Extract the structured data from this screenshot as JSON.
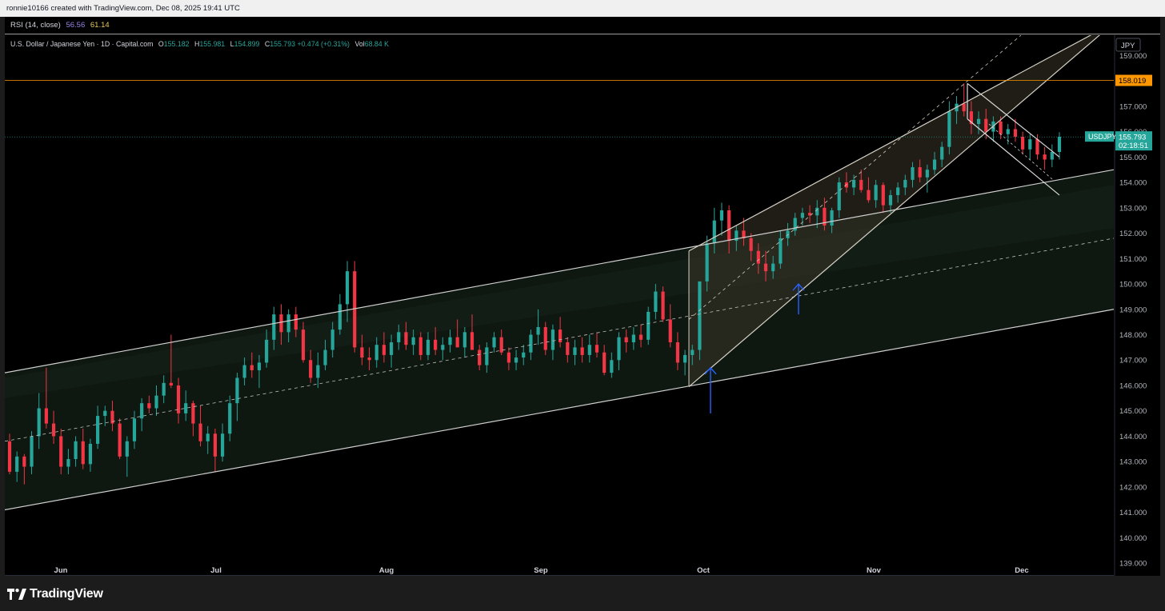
{
  "header": {
    "credit": "ronnie10166 created with TradingView.com, Dec 08, 2025 19:41 UTC"
  },
  "rsi": {
    "label": "RSI (14, close)",
    "value1": "56.56",
    "value2": "61.14"
  },
  "legend": {
    "symbol": "U.S. Dollar / Japanese Yen · 1D · Capital.com",
    "o_label": "O",
    "o": "155.182",
    "h_label": "H",
    "h": "155.981",
    "l_label": "L",
    "l": "154.899",
    "c_label": "C",
    "c": "155.793",
    "change": "+0.474 (+0.31%)",
    "vol_label": "Vol",
    "vol": "68.84 K"
  },
  "brand": {
    "name": "TradingView"
  },
  "chart_data": {
    "type": "candlestick",
    "currency": "JPY",
    "ticker": "USDJPY",
    "last_price": "155.793",
    "countdown": "02:18:51",
    "resistance": "158.019",
    "y_ticks": [
      "159.000",
      "158.000",
      "157.000",
      "156.000",
      "155.000",
      "154.000",
      "153.000",
      "152.000",
      "151.000",
      "150.000",
      "149.000",
      "148.000",
      "147.000",
      "146.000",
      "145.000",
      "144.000",
      "143.000",
      "142.000",
      "141.000",
      "140.000",
      "139.000"
    ],
    "x_ticks": [
      "Jun",
      "Jul",
      "Aug",
      "Sep",
      "Oct",
      "Nov",
      "Dec"
    ],
    "ylim": [
      138.5,
      159.8
    ],
    "colors": {
      "up": "#26a69a",
      "down": "#f23645",
      "resistance": "#ff9800",
      "arrows": "#2962ff"
    },
    "candles": [
      [
        143.8,
        144.1,
        142.5,
        142.6
      ],
      [
        142.6,
        143.4,
        142.2,
        143.2
      ],
      [
        143.2,
        143.3,
        142.1,
        142.8
      ],
      [
        142.8,
        144.2,
        142.5,
        144.0
      ],
      [
        144.0,
        145.7,
        143.5,
        145.1
      ],
      [
        145.1,
        146.7,
        144.3,
        144.5
      ],
      [
        144.5,
        145.0,
        143.7,
        144.0
      ],
      [
        144.0,
        144.3,
        142.5,
        142.8
      ],
      [
        142.8,
        143.5,
        142.5,
        143.1
      ],
      [
        143.1,
        144.0,
        142.8,
        143.8
      ],
      [
        143.8,
        144.3,
        142.7,
        142.9
      ],
      [
        142.9,
        143.9,
        142.6,
        143.7
      ],
      [
        143.7,
        145.2,
        143.5,
        144.8
      ],
      [
        144.8,
        145.2,
        144.4,
        145.0
      ],
      [
        145.0,
        145.4,
        144.2,
        144.5
      ],
      [
        144.5,
        144.7,
        143.1,
        143.2
      ],
      [
        143.2,
        144.0,
        142.4,
        143.8
      ],
      [
        143.8,
        145.0,
        143.5,
        144.7
      ],
      [
        144.7,
        145.5,
        144.2,
        145.3
      ],
      [
        145.3,
        145.6,
        144.9,
        145.1
      ],
      [
        145.1,
        146.0,
        144.8,
        145.6
      ],
      [
        145.6,
        146.4,
        145.3,
        146.1
      ],
      [
        146.1,
        148.0,
        145.9,
        146.0
      ],
      [
        146.0,
        146.3,
        144.5,
        144.9
      ],
      [
        144.9,
        145.8,
        144.6,
        145.3
      ],
      [
        145.3,
        145.4,
        144.0,
        144.5
      ],
      [
        144.5,
        145.2,
        143.6,
        143.8
      ],
      [
        143.8,
        144.4,
        143.3,
        144.1
      ],
      [
        144.1,
        144.3,
        142.6,
        143.2
      ],
      [
        143.2,
        144.5,
        143.0,
        144.1
      ],
      [
        144.1,
        145.6,
        143.8,
        145.3
      ],
      [
        145.3,
        146.5,
        144.6,
        146.3
      ],
      [
        146.3,
        147.1,
        146.0,
        146.8
      ],
      [
        146.8,
        147.3,
        146.3,
        146.6
      ],
      [
        146.6,
        147.2,
        145.9,
        146.9
      ],
      [
        146.9,
        148.2,
        146.7,
        147.8
      ],
      [
        147.8,
        149.1,
        147.4,
        148.8
      ],
      [
        148.8,
        149.2,
        147.6,
        148.1
      ],
      [
        148.1,
        149.0,
        147.7,
        148.8
      ],
      [
        148.8,
        149.1,
        147.9,
        148.2
      ],
      [
        148.2,
        148.5,
        146.9,
        147.0
      ],
      [
        147.0,
        147.4,
        146.1,
        146.3
      ],
      [
        146.3,
        147.3,
        145.9,
        146.8
      ],
      [
        146.8,
        147.8,
        146.6,
        147.4
      ],
      [
        147.4,
        148.5,
        147.1,
        148.2
      ],
      [
        148.2,
        149.6,
        148.0,
        149.2
      ],
      [
        149.2,
        150.9,
        148.5,
        150.5
      ],
      [
        150.5,
        150.9,
        147.3,
        147.5
      ],
      [
        147.5,
        148.0,
        146.8,
        147.1
      ],
      [
        147.1,
        147.5,
        146.6,
        147.0
      ],
      [
        147.0,
        147.9,
        146.7,
        147.6
      ],
      [
        147.6,
        148.1,
        146.9,
        147.2
      ],
      [
        147.2,
        148.0,
        146.7,
        147.7
      ],
      [
        147.7,
        148.4,
        147.4,
        148.1
      ],
      [
        148.1,
        148.5,
        147.4,
        147.6
      ],
      [
        147.6,
        148.2,
        147.2,
        147.9
      ],
      [
        147.9,
        148.1,
        147.0,
        147.2
      ],
      [
        147.2,
        148.1,
        147.0,
        147.8
      ],
      [
        147.8,
        148.3,
        147.2,
        147.4
      ],
      [
        147.4,
        147.9,
        147.0,
        147.6
      ],
      [
        147.6,
        148.2,
        147.3,
        147.9
      ],
      [
        147.9,
        148.6,
        147.5,
        147.5
      ],
      [
        147.5,
        148.3,
        147.1,
        148.1
      ],
      [
        148.1,
        148.8,
        147.6,
        147.4
      ],
      [
        147.4,
        147.6,
        146.6,
        146.8
      ],
      [
        146.8,
        147.7,
        146.5,
        147.5
      ],
      [
        147.5,
        148.1,
        147.3,
        147.9
      ],
      [
        147.9,
        148.2,
        147.2,
        147.3
      ],
      [
        147.3,
        147.5,
        146.6,
        146.9
      ],
      [
        146.9,
        147.4,
        146.6,
        147.1
      ],
      [
        147.1,
        147.6,
        146.8,
        147.3
      ],
      [
        147.3,
        148.2,
        147.0,
        148.0
      ],
      [
        148.0,
        149.0,
        147.6,
        148.3
      ],
      [
        148.3,
        148.5,
        147.2,
        147.4
      ],
      [
        147.4,
        148.4,
        147.0,
        148.2
      ],
      [
        148.2,
        148.7,
        147.5,
        147.7
      ],
      [
        147.7,
        147.9,
        146.9,
        147.2
      ],
      [
        147.2,
        147.8,
        146.8,
        147.5
      ],
      [
        147.5,
        147.9,
        146.9,
        147.2
      ],
      [
        147.2,
        148.0,
        146.9,
        147.6
      ],
      [
        147.6,
        148.1,
        147.1,
        147.3
      ],
      [
        147.3,
        147.6,
        146.4,
        146.5
      ],
      [
        146.5,
        147.3,
        146.3,
        147.0
      ],
      [
        147.0,
        148.1,
        146.6,
        147.9
      ],
      [
        147.9,
        148.2,
        147.3,
        147.7
      ],
      [
        147.7,
        148.3,
        147.4,
        148.0
      ],
      [
        148.0,
        148.4,
        147.5,
        147.8
      ],
      [
        147.8,
        149.1,
        147.6,
        148.9
      ],
      [
        148.9,
        150.0,
        148.6,
        149.7
      ],
      [
        149.7,
        149.9,
        148.5,
        148.6
      ],
      [
        148.6,
        149.2,
        147.5,
        147.7
      ],
      [
        147.7,
        148.1,
        146.6,
        146.9
      ],
      [
        146.9,
        147.4,
        146.4,
        147.2
      ],
      [
        147.2,
        147.6,
        146.8,
        147.4
      ],
      [
        147.4,
        149.7,
        147.0,
        150.1
      ],
      [
        150.1,
        151.9,
        149.7,
        151.6
      ],
      [
        151.6,
        153.0,
        151.2,
        152.5
      ],
      [
        152.5,
        153.2,
        151.9,
        152.9
      ],
      [
        152.9,
        153.1,
        151.2,
        151.7
      ],
      [
        151.7,
        152.3,
        151.3,
        152.1
      ],
      [
        152.1,
        152.6,
        151.5,
        151.8
      ],
      [
        151.8,
        152.0,
        150.9,
        151.3
      ],
      [
        151.3,
        151.6,
        150.4,
        150.8
      ],
      [
        150.8,
        151.3,
        150.1,
        150.5
      ],
      [
        150.5,
        151.1,
        150.2,
        150.8
      ],
      [
        150.8,
        152.1,
        150.6,
        151.8
      ],
      [
        151.8,
        152.4,
        151.5,
        152.1
      ],
      [
        152.1,
        152.8,
        151.9,
        152.6
      ],
      [
        152.6,
        153.0,
        152.3,
        152.8
      ],
      [
        152.8,
        153.1,
        152.4,
        152.7
      ],
      [
        152.7,
        153.3,
        152.2,
        153.0
      ],
      [
        153.0,
        153.4,
        152.1,
        152.3
      ],
      [
        152.3,
        153.0,
        152.0,
        152.9
      ],
      [
        152.9,
        154.2,
        152.6,
        154.0
      ],
      [
        154.0,
        154.4,
        153.6,
        153.8
      ],
      [
        153.8,
        154.3,
        153.5,
        154.1
      ],
      [
        154.1,
        154.5,
        153.6,
        153.7
      ],
      [
        153.7,
        154.2,
        153.2,
        153.3
      ],
      [
        153.3,
        154.1,
        153.0,
        153.9
      ],
      [
        153.9,
        154.0,
        152.8,
        153.1
      ],
      [
        153.1,
        153.7,
        152.8,
        153.5
      ],
      [
        153.5,
        154.0,
        153.2,
        153.8
      ],
      [
        153.8,
        154.3,
        153.5,
        154.1
      ],
      [
        154.1,
        154.8,
        153.8,
        154.6
      ],
      [
        154.6,
        154.9,
        154.0,
        154.2
      ],
      [
        154.2,
        154.7,
        153.6,
        154.5
      ],
      [
        154.5,
        155.2,
        154.3,
        154.9
      ],
      [
        154.9,
        155.6,
        154.6,
        155.4
      ],
      [
        155.4,
        157.2,
        155.1,
        156.8
      ],
      [
        156.8,
        157.4,
        156.3,
        157.1
      ],
      [
        157.1,
        157.9,
        156.6,
        156.8
      ],
      [
        156.8,
        157.2,
        155.9,
        156.3
      ],
      [
        156.3,
        156.8,
        155.9,
        156.5
      ],
      [
        156.5,
        156.9,
        155.7,
        156.0
      ],
      [
        156.0,
        156.6,
        155.6,
        156.4
      ],
      [
        156.4,
        156.6,
        155.7,
        155.9
      ],
      [
        155.9,
        156.3,
        155.5,
        156.1
      ],
      [
        156.1,
        156.5,
        155.6,
        155.8
      ],
      [
        155.8,
        156.0,
        155.1,
        155.3
      ],
      [
        155.3,
        155.9,
        154.9,
        155.7
      ],
      [
        155.7,
        155.9,
        154.9,
        155.1
      ],
      [
        155.1,
        155.4,
        154.5,
        154.9
      ],
      [
        154.9,
        155.5,
        154.6,
        155.2
      ],
      [
        155.2,
        155.98,
        154.9,
        155.8
      ]
    ]
  }
}
